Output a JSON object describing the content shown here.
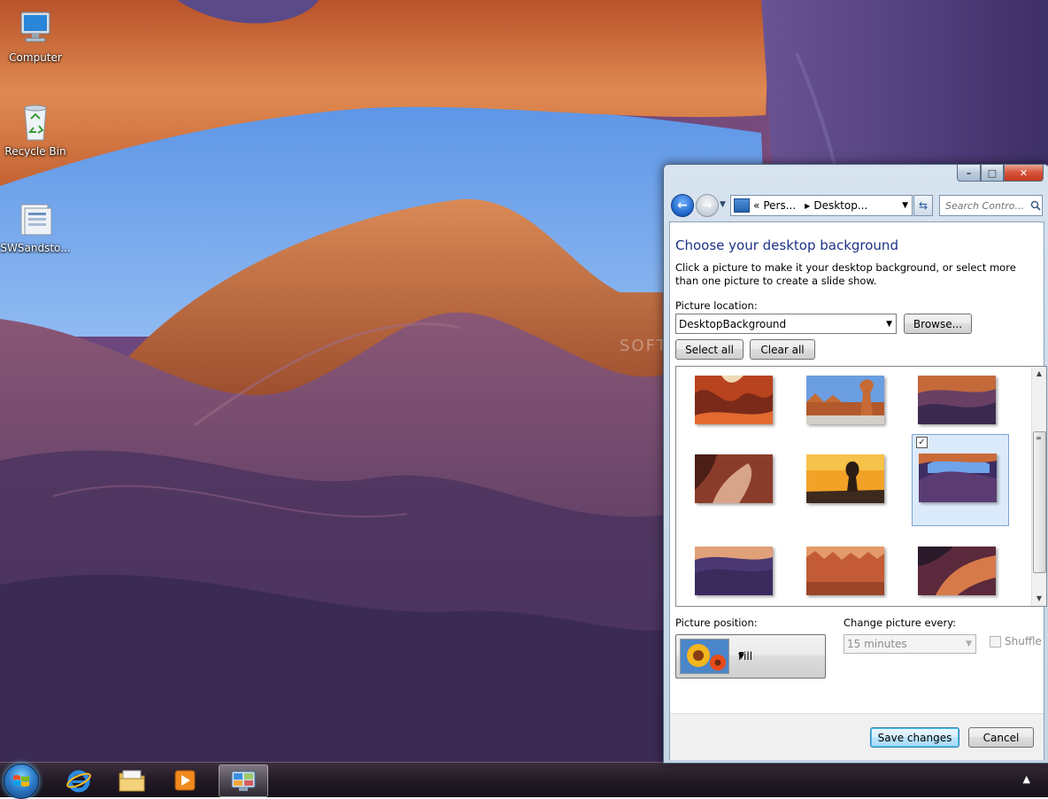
{
  "desktop": {
    "icons": [
      {
        "label": "Computer"
      },
      {
        "label": "Recycle Bin"
      },
      {
        "label": "SWSandsto..."
      }
    ],
    "watermark": "SOFTPEDIA"
  },
  "window": {
    "controls": {
      "minimize": "–",
      "maximize": "□",
      "close": "✕"
    },
    "nav": {
      "back_glyph": "←",
      "forward_glyph": "→",
      "dropdown_glyph": "▼"
    },
    "address": {
      "prefix": "«",
      "crumb1": "Pers...",
      "crumb2": "Desktop...",
      "arrow": "▶",
      "dropdown_glyph": "▼"
    },
    "refresh_glyph": "⇆",
    "search": {
      "placeholder": "Search Contro..."
    },
    "title": "Choose your desktop background",
    "description": "Click a picture to make it your desktop background, or select more than one picture to create a slide show.",
    "picture_location": {
      "label": "Picture location:",
      "value": "DesktopBackground",
      "browse": "Browse..."
    },
    "select_all": "Select all",
    "clear_all": "Clear all",
    "gallery": {
      "selected_index": 5,
      "check_glyph": "✓",
      "scroll_up": "▲",
      "scroll_down": "▼",
      "grip": "≡"
    },
    "picture_position": {
      "label": "Picture position:",
      "value": "Fill"
    },
    "change_picture": {
      "label": "Change picture every:",
      "value": "15 minutes"
    },
    "shuffle": {
      "label": "Shuffle",
      "checked": false
    },
    "save": "Save changes",
    "cancel": "Cancel"
  },
  "taskbar": {
    "tray_chevron": "▲"
  },
  "colors": {
    "title_blue": "#1e3287",
    "selection": "#dcebfc"
  }
}
